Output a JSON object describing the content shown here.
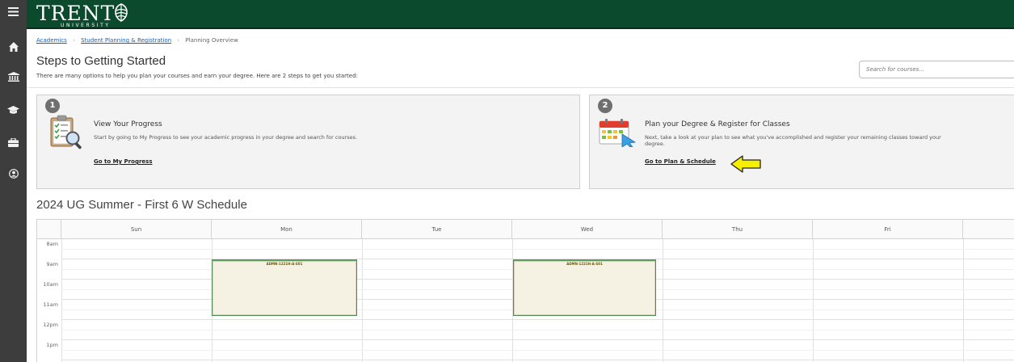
{
  "brand": {
    "wordmark": "TRENT",
    "sub": "UNIVERSITY",
    "header_color": "#0b4a2c"
  },
  "rail": {
    "icons": [
      "menu-icon",
      "home-icon",
      "institution-icon",
      "graduation-cap-icon",
      "briefcase-icon",
      "user-icon"
    ]
  },
  "breadcrumb": {
    "items": [
      "Academics",
      "Student Planning & Registration",
      "Planning Overview"
    ],
    "separator": "›"
  },
  "page": {
    "title": "Steps to Getting Started",
    "subtitle": "There are many options to help you plan your courses and earn your degree. Here are 2 steps to get you started:"
  },
  "search": {
    "placeholder": "Search for courses..."
  },
  "steps": [
    {
      "number": "1",
      "title": "View Your Progress",
      "description": "Start by going to My Progress to see your academic progress in your degree and search for courses.",
      "link": "Go to My Progress",
      "icon": "clipboard-magnifier-icon"
    },
    {
      "number": "2",
      "title": "Plan your Degree & Register for Classes",
      "description": "Next, take a look at your plan to see what you've accomplished and register your remaining classes toward your degree.",
      "link": "Go to Plan & Schedule",
      "icon": "calendar-cursor-icon",
      "annotation": "yellow-arrow-icon",
      "annotation_color": "#f7ef00"
    }
  ],
  "schedule": {
    "title": "2024 UG Summer - First 6 W Schedule",
    "days": [
      "Sun",
      "Mon",
      "Tue",
      "Wed",
      "Thu",
      "Fri"
    ],
    "times": [
      "8am",
      "9am",
      "10am",
      "11am",
      "12pm",
      "1pm"
    ],
    "events": [
      {
        "day": "Mon",
        "label": "ADMN-1221H-A-S01",
        "start": "9am",
        "end": "11:30am"
      },
      {
        "day": "Wed",
        "label": "ADMN-1221H-A-S01",
        "start": "9am",
        "end": "11:30am"
      }
    ],
    "event_color": "#f5f1e3"
  }
}
